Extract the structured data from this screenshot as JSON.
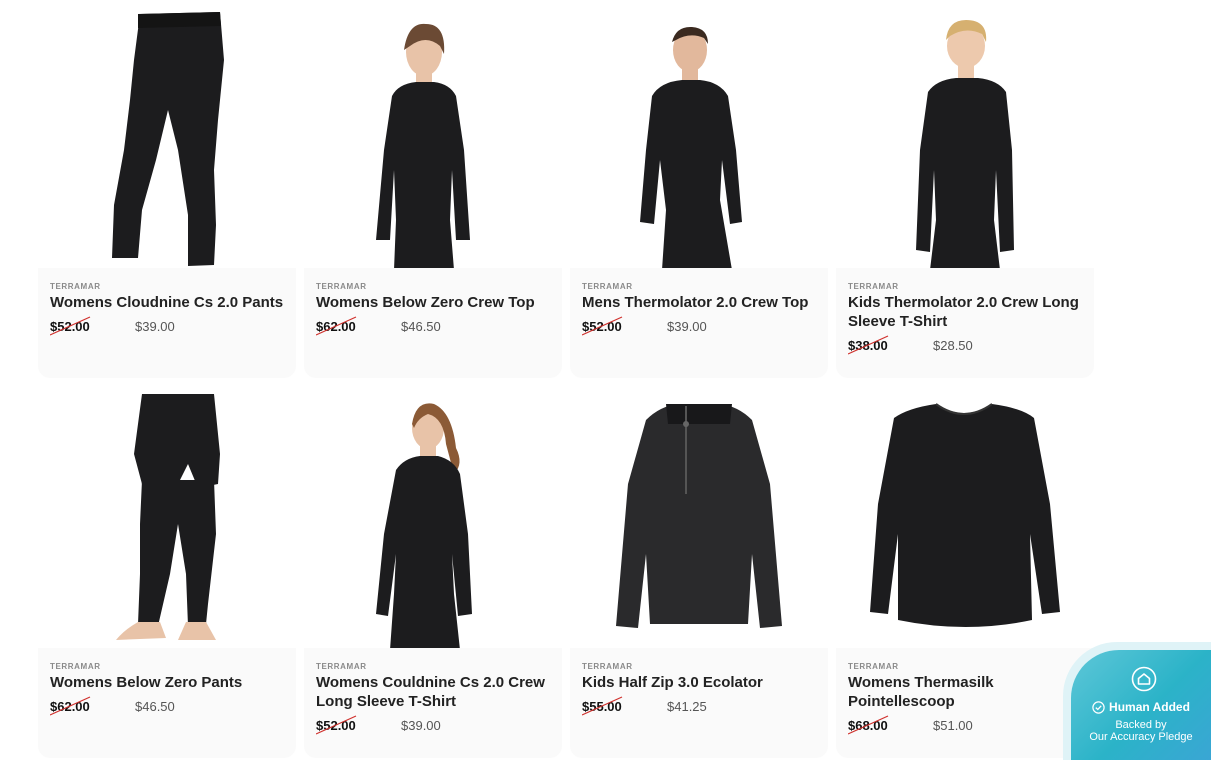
{
  "products": [
    {
      "brand": "TERRAMAR",
      "title": "Womens Cloudnine Cs 2.0 Pants",
      "old_price": "$52.00",
      "new_price": "$39.00"
    },
    {
      "brand": "TERRAMAR",
      "title": "Womens Below Zero Crew Top",
      "old_price": "$62.00",
      "new_price": "$46.50"
    },
    {
      "brand": "TERRAMAR",
      "title": "Mens Thermolator 2.0 Crew Top",
      "old_price": "$52.00",
      "new_price": "$39.00"
    },
    {
      "brand": "TERRAMAR",
      "title": "Kids Thermolator 2.0 Crew Long Sleeve T-Shirt",
      "old_price": "$38.00",
      "new_price": "$28.50"
    },
    {
      "brand": "TERRAMAR",
      "title": "Womens Below Zero Pants",
      "old_price": "$62.00",
      "new_price": "$46.50"
    },
    {
      "brand": "TERRAMAR",
      "title": "Womens Couldnine Cs 2.0 Crew Long Sleeve T-Shirt",
      "old_price": "$52.00",
      "new_price": "$39.00"
    },
    {
      "brand": "TERRAMAR",
      "title": "Kids Half Zip 3.0 Ecolator",
      "old_price": "$55.00",
      "new_price": "$41.25"
    },
    {
      "brand": "TERRAMAR",
      "title": "Womens Thermasilk Pointellescoop",
      "old_price": "$68.00",
      "new_price": "$51.00"
    }
  ],
  "badge": {
    "label": "Human Added",
    "line1": "Backed by",
    "line2": "Our Accuracy Pledge",
    "icon": "home-icon"
  },
  "colors": {
    "strike": "#d0312d",
    "garment": "#1c1c1e",
    "skin": "#e8c3a8",
    "badge": "#2bb3c8"
  }
}
